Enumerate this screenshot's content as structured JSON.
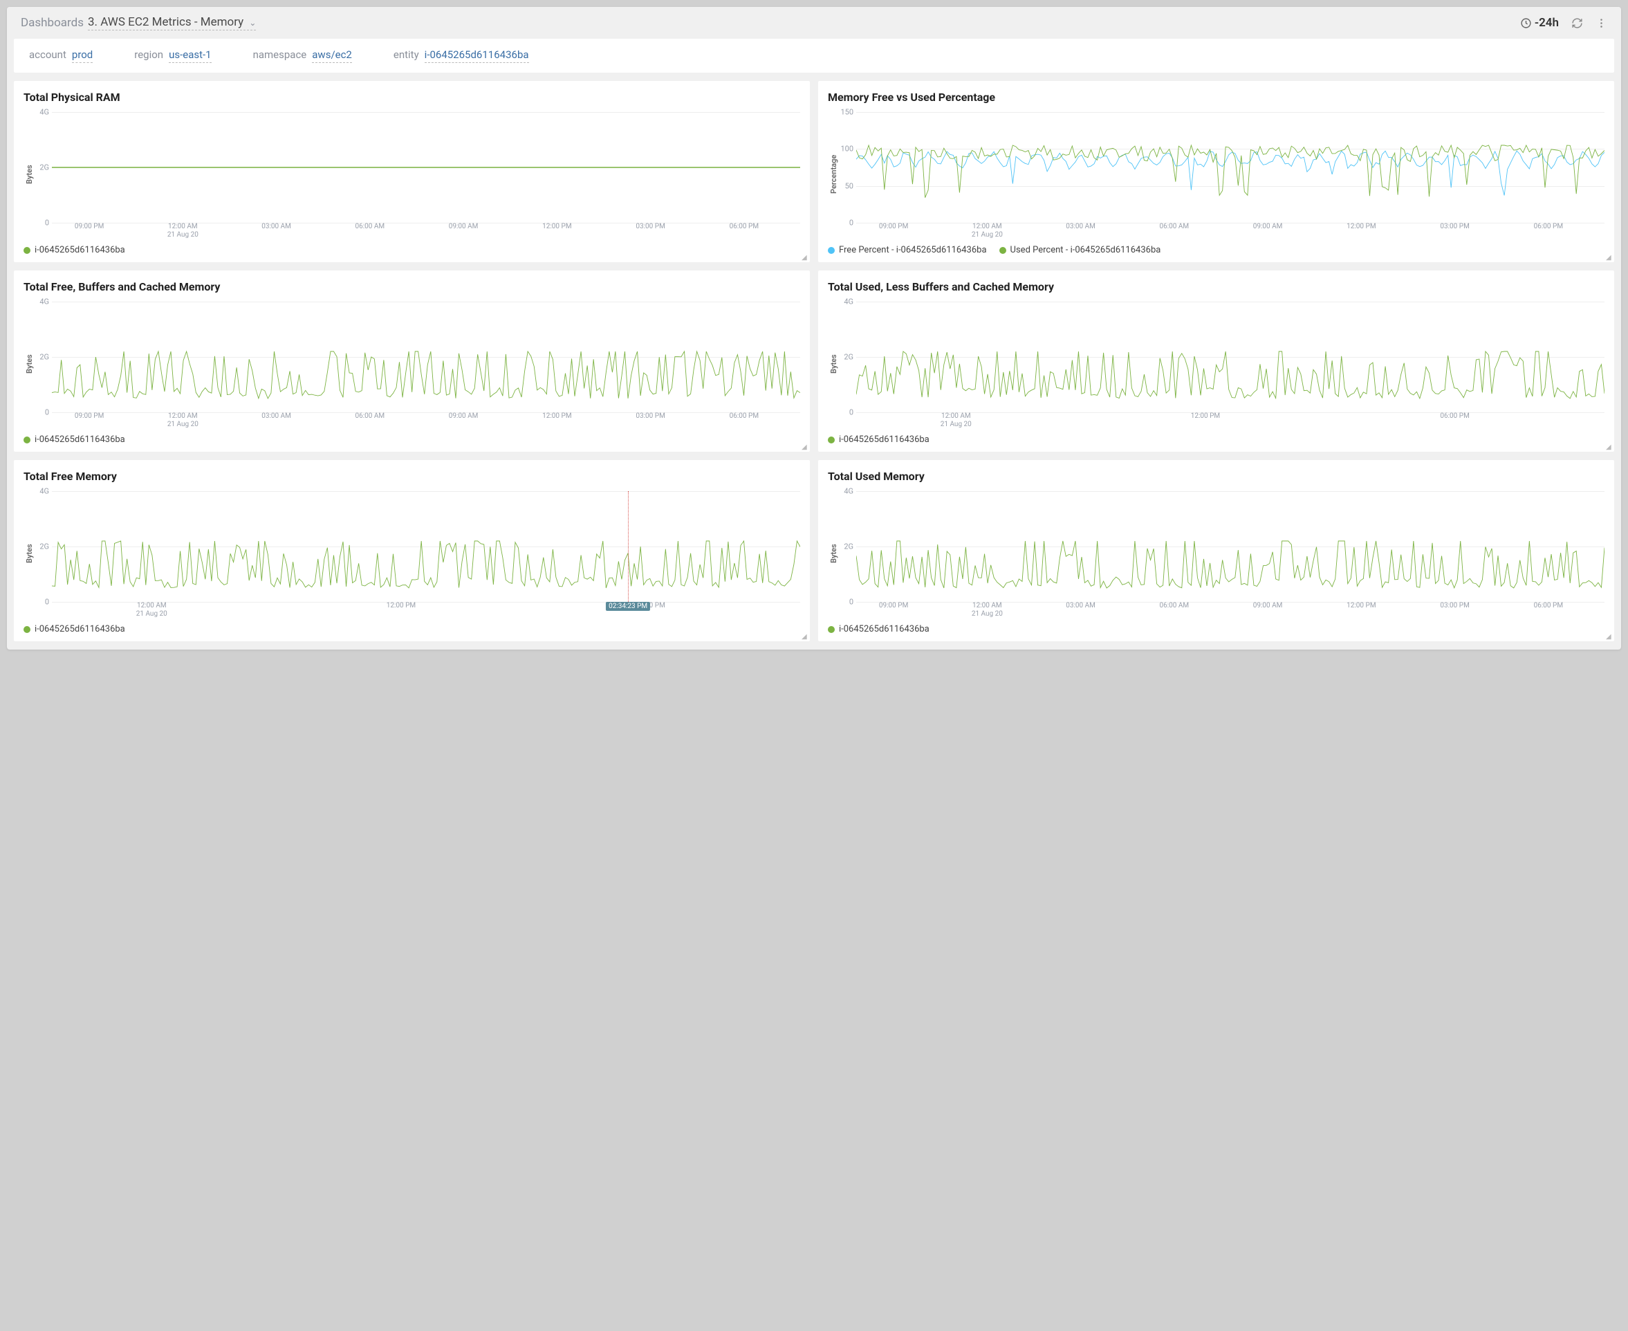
{
  "header": {
    "breadcrumb_root": "Dashboards",
    "breadcrumb_current": "3. AWS EC2 Metrics - Memory",
    "time_range": "-24h"
  },
  "filters": [
    {
      "label": "account",
      "value": "prod"
    },
    {
      "label": "region",
      "value": "us-east-1"
    },
    {
      "label": "namespace",
      "value": "aws/ec2"
    },
    {
      "label": "entity",
      "value": "i-0645265d6116436ba"
    }
  ],
  "colors": {
    "green": "#7cb342",
    "blue": "#4fc3f7"
  },
  "xaxis": {
    "ticks": [
      "09:00 PM",
      "12:00 AM",
      "03:00 AM",
      "06:00 AM",
      "09:00 AM",
      "12:00 PM",
      "03:00 PM",
      "06:00 PM"
    ],
    "date_under_index": 1,
    "date_label": "21 Aug 20"
  },
  "xaxis_alt": {
    "ticks": [
      "12:00 AM",
      "12:00 PM",
      "06:00 PM"
    ],
    "date_under_index": 0,
    "date_label": "21 Aug 20"
  },
  "cursor": {
    "panel_index": 4,
    "x_pct": 77,
    "label": "02:34:23 PM"
  },
  "chart_data": [
    {
      "title": "Total Physical RAM",
      "ylabel": "Bytes",
      "type": "line",
      "ylim": [
        0,
        4
      ],
      "yticks": [
        "0",
        "2G",
        "4G"
      ],
      "xticks_key": "xaxis",
      "legend": [
        {
          "name": "i-0645265d6116436ba",
          "color": "green"
        }
      ],
      "series": [
        {
          "name": "i-0645265d6116436ba",
          "color": "green",
          "data_key": "ram"
        }
      ]
    },
    {
      "title": "Memory Free vs Used Percentage",
      "ylabel": "Percentage",
      "type": "line",
      "ylim": [
        0,
        150
      ],
      "yticks": [
        "0",
        "50",
        "100",
        "150"
      ],
      "xticks_key": "xaxis",
      "legend": [
        {
          "name": "Free Percent - i-0645265d6116436ba",
          "color": "blue"
        },
        {
          "name": "Used Percent - i-0645265d6116436ba",
          "color": "green"
        }
      ],
      "series": [
        {
          "name": "Free Percent",
          "color": "blue",
          "data_key": "free_pct"
        },
        {
          "name": "Used Percent",
          "color": "green",
          "data_key": "used_pct"
        }
      ]
    },
    {
      "title": "Total Free, Buffers and Cached Memory",
      "ylabel": "Bytes",
      "type": "line",
      "ylim": [
        0,
        4
      ],
      "yticks": [
        "0",
        "2G",
        "4G"
      ],
      "xticks_key": "xaxis",
      "legend": [
        {
          "name": "i-0645265d6116436ba",
          "color": "green"
        }
      ],
      "series": [
        {
          "name": "i-0645265d6116436ba",
          "color": "green",
          "data_key": "free_buf_cache"
        }
      ]
    },
    {
      "title": "Total Used, Less Buffers and Cached Memory",
      "ylabel": "Bytes",
      "type": "line",
      "ylim": [
        0,
        4
      ],
      "yticks": [
        "0",
        "2G",
        "4G"
      ],
      "xticks_key": "xaxis_alt",
      "legend": [
        {
          "name": "i-0645265d6116436ba",
          "color": "green"
        }
      ],
      "series": [
        {
          "name": "i-0645265d6116436ba",
          "color": "green",
          "data_key": "used_less_buf"
        }
      ]
    },
    {
      "title": "Total Free Memory",
      "ylabel": "Bytes",
      "type": "line",
      "ylim": [
        0,
        4
      ],
      "yticks": [
        "0",
        "2G",
        "4G"
      ],
      "xticks_key": "xaxis_alt",
      "legend": [
        {
          "name": "i-0645265d6116436ba",
          "color": "green"
        }
      ],
      "series": [
        {
          "name": "i-0645265d6116436ba",
          "color": "green",
          "data_key": "free_mem"
        }
      ],
      "has_cursor": true
    },
    {
      "title": "Total Used Memory",
      "ylabel": "Bytes",
      "type": "line",
      "ylim": [
        0,
        4
      ],
      "yticks": [
        "0",
        "2G",
        "4G"
      ],
      "xticks_key": "xaxis",
      "legend": [
        {
          "name": "i-0645265d6116436ba",
          "color": "green"
        }
      ],
      "series": [
        {
          "name": "i-0645265d6116436ba",
          "color": "green",
          "data_key": "used_mem"
        }
      ]
    }
  ]
}
